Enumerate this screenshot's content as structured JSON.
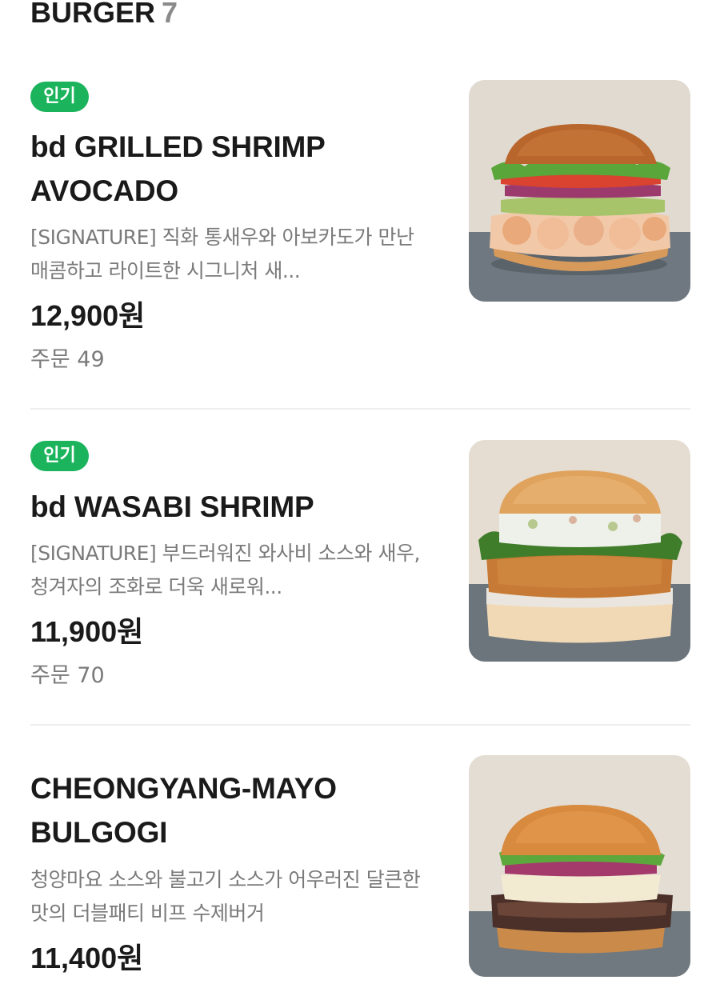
{
  "section": {
    "title": "BURGER",
    "count": "7"
  },
  "items": [
    {
      "badge": "인기",
      "name": "bd GRILLED SHRIMP AVOCADO",
      "description": "[SIGNATURE] 직화 통새우와 아보카도가 만난 매콤하고 라이트한 시그니처 새...",
      "price": "12,900원",
      "orders": "주문 49",
      "image": "grilled-shrimp-avocado-burger-photo"
    },
    {
      "badge": "인기",
      "name": "bd WASABI SHRIMP",
      "description": "[SIGNATURE] 부드러워진 와사비 소스와 새우, 청겨자의 조화로 더욱 새로워...",
      "price": "11,900원",
      "orders": "주문 70",
      "image": "wasabi-shrimp-burger-photo"
    },
    {
      "name": "CHEONGYANG-MAYO BULGOGI",
      "description": "청양마요 소스와 불고기 소스가 어우러진 달큰한 맛의 더블패티 비프 수제버거",
      "price": "11,400원",
      "image": "cheongyang-mayo-bulgogi-burger-photo"
    }
  ],
  "colors": {
    "badge": "#1bb45c",
    "text": "#1a1a1a",
    "muted": "#7a7a7a",
    "divider": "#eeeeee"
  }
}
